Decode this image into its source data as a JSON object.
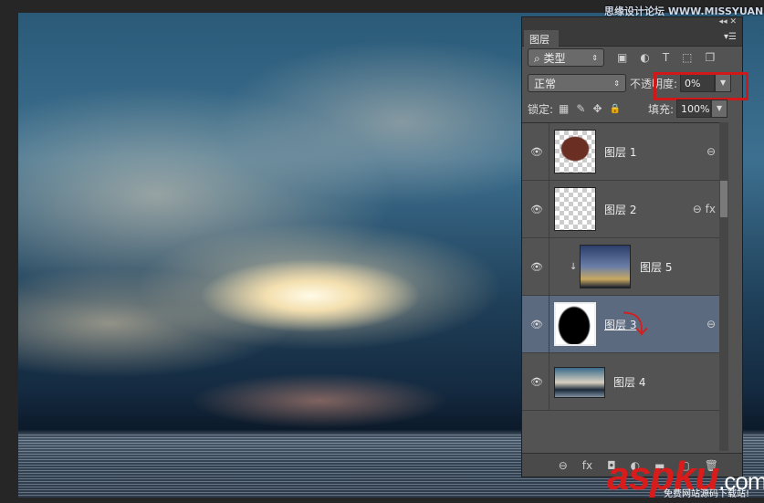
{
  "watermark": "思缘设计论坛 WWW.MISSYUAN.COM",
  "panel": {
    "collapse": "◂◂ ✕",
    "tab": "图层",
    "menu_icon": "menu-icon",
    "filter": {
      "label": "⌕ 类型",
      "icons": [
        "▣",
        "◐",
        "T",
        "⬚",
        "❐"
      ]
    },
    "blend_mode": "正常",
    "opacity_label": "不透明度:",
    "opacity": "0%",
    "lock_label": "锁定:",
    "lock_icons": [
      "▦",
      "✎",
      "✥",
      "🔒"
    ],
    "fill_label": "填充:",
    "fill": "100%",
    "layers": [
      {
        "name": "图层 1",
        "link": "⊖"
      },
      {
        "name": "图层 2",
        "link": "⊖ fx"
      },
      {
        "name": "图层 5",
        "clip": "↓"
      },
      {
        "name": "图层 3",
        "link": "⊖"
      },
      {
        "name": "图层 4"
      }
    ],
    "bottom_icons": [
      "⊖",
      "fx",
      "◘",
      "◐",
      "▬",
      "▢",
      "🗑"
    ]
  },
  "logo": {
    "main": "aspku",
    "suffix": ".com",
    "sub": "免费网站源码下载站!"
  }
}
